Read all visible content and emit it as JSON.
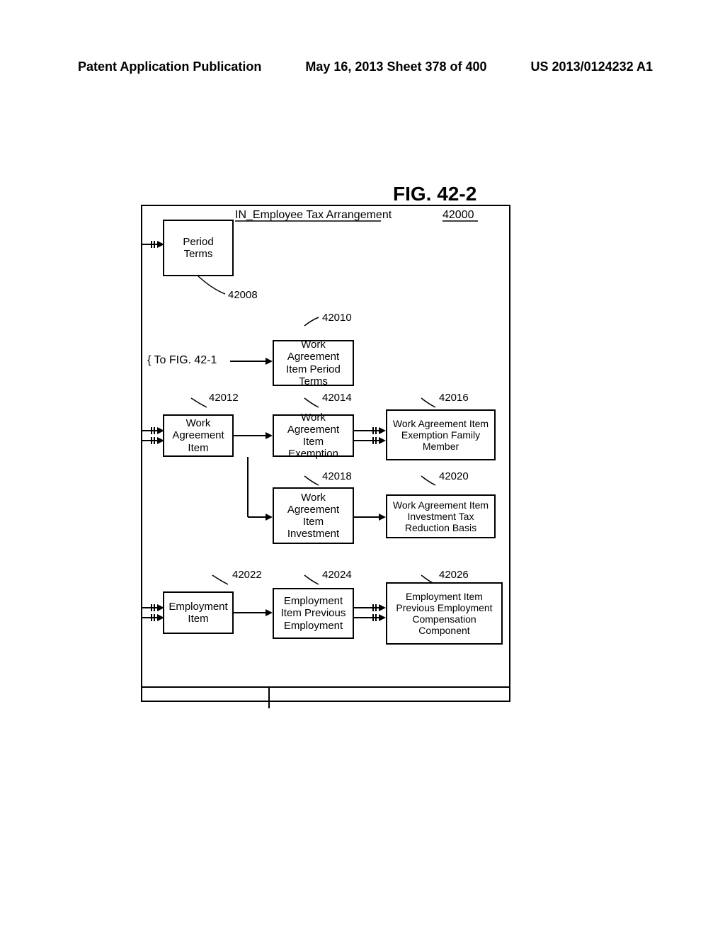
{
  "header": {
    "left": "Patent Application Publication",
    "center": "May 16, 2013  Sheet 378 of 400",
    "right": "US 2013/0124232 A1"
  },
  "figure_title": "FIG. 42-2",
  "to_fig": "{ To FIG. 42-1",
  "root": {
    "title": "IN_Employee Tax Arrangement",
    "ref": "42000"
  },
  "boxes": {
    "period_terms": {
      "label": "Period Terms",
      "ref": "42008"
    },
    "wai_period_terms": {
      "label": "Work Agreement Item Period Terms",
      "ref": "42010"
    },
    "wai": {
      "label": "Work Agreement Item",
      "ref": "42012"
    },
    "wai_exemption": {
      "label": "Work Agreement Item Exemption",
      "ref": "42014"
    },
    "wai_exemption_fam": {
      "label": "Work Agreement Item Exemption Family Member",
      "ref": "42016"
    },
    "wai_investment": {
      "label": "Work Agreement Item Investment",
      "ref": "42018"
    },
    "wai_inv_tax_basis": {
      "label": "Work Agreement Item Investment Tax Reduction Basis",
      "ref": "42020"
    },
    "emp_item": {
      "label": "Employment Item",
      "ref": "42022"
    },
    "emp_item_prev": {
      "label": "Employment Item Previous Employment",
      "ref": "42024"
    },
    "emp_item_prev_comp": {
      "label": "Employment Item Previous Employment Compensation Component",
      "ref": "42026"
    }
  }
}
